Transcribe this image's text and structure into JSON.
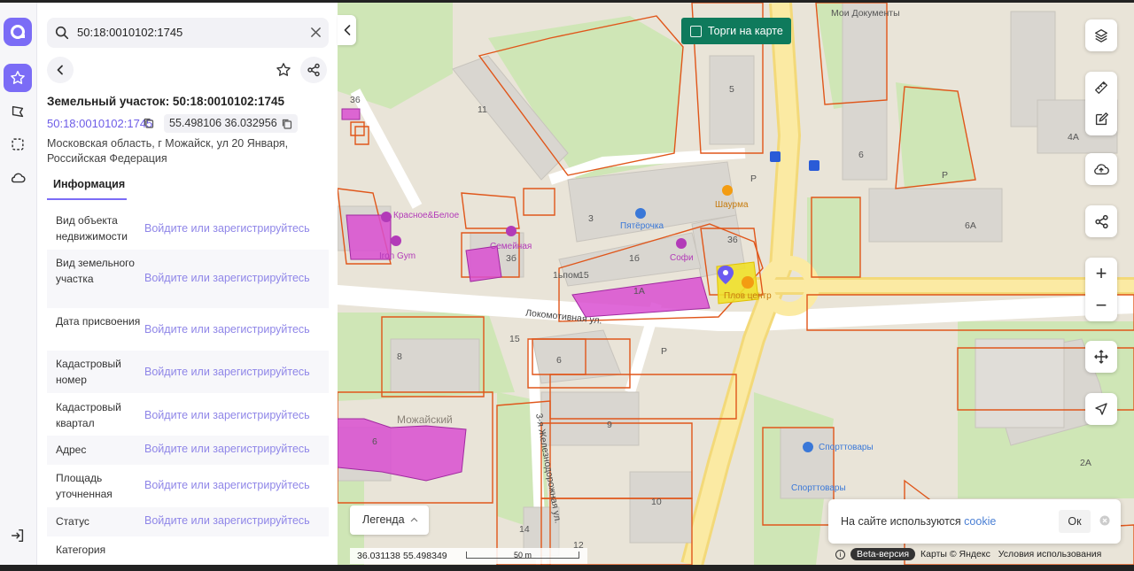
{
  "search": {
    "query": "50:18:0010102:1745"
  },
  "panel": {
    "title": "Земельный участок: 50:18:0010102:1745",
    "cadastral_link": "50:18:0010102:1745",
    "coords": "55.498106 36.032956",
    "address_line1": "Московская область, г Можайск, ул 20 Января,",
    "address_line2": "Российская Федерация",
    "tab_info": "Информация",
    "props": [
      {
        "label": "Вид объекта недвижимости",
        "value": "Войдите или зарегистрируйтесь"
      },
      {
        "label": "Вид земельного участка",
        "value": "Войдите или зарегистрируйтесь"
      },
      {
        "label": "Дата присвоения",
        "value": "Войдите или зарегистрируйтесь"
      },
      {
        "label": "Кадастровый номер",
        "value": "Войдите или зарегистрируйтесь"
      },
      {
        "label": "Кадастровый квартал",
        "value": "Войдите или зарегистрируйтесь"
      },
      {
        "label": "Адрес",
        "value": "Войдите или зарегистрируйтесь"
      },
      {
        "label": "Площадь уточненная",
        "value": "Войдите или зарегистрируйтесь"
      },
      {
        "label": "Статус",
        "value": "Войдите или зарегистрируйтесь"
      },
      {
        "label": "Категория",
        "value": ""
      }
    ]
  },
  "map": {
    "trade_toggle": "Торги на карте",
    "legend": "Легенда",
    "cursor_lon": "36.031138",
    "cursor_lat": "55.498349",
    "scale": "50 m",
    "cookie_text": "На сайте используются",
    "cookie_link": "cookie",
    "cookie_ok": "Ок",
    "beta": "Beta-версия",
    "yandex": "Карты © Яндекс",
    "terms": "Условия использования",
    "labels": {
      "street_lokomotivnaya": "Локомотивная ул.",
      "street_zhd": "3-я Железнодорожная ул.",
      "district": "Можайский",
      "my_docs": "Мои Документы",
      "krasnoe": "Красное&Белое",
      "pyaterochka": "Пятёрочка",
      "shaurma": "Шаурма",
      "sofi": "Софи",
      "semeynaya": "Семейная",
      "iron": "Iron Gym",
      "plovcentr": "Плов центр",
      "sport1": "Спорттовары",
      "sport2": "Спорттовары",
      "tylpom": "1ьпом",
      "b5": "5",
      "b11": "11",
      "b36": "36",
      "b3": "3",
      "b6": "6",
      "b6a": "6А",
      "b4a": "4А",
      "b1a": "1А",
      "b1b": "1б",
      "b15": "15",
      "b15b": "15",
      "b3b": "3б",
      "b8": "8",
      "b6b": "6",
      "b9": "9",
      "b10": "10",
      "b14": "14",
      "b12": "12",
      "b2a": "2А",
      "b6c": "6",
      "bP1": "Р",
      "bP2": "Р",
      "bP3": "Р"
    }
  }
}
